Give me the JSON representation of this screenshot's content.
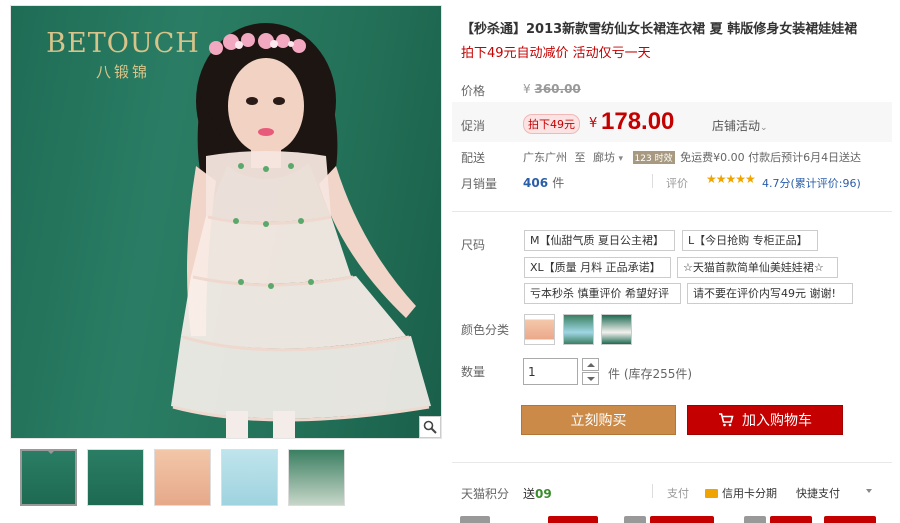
{
  "gallery": {
    "brand_en": "BETOUCH",
    "brand_cn": "八锻锦",
    "thumbnails": [
      "thumb-1",
      "thumb-2",
      "thumb-3",
      "thumb-4",
      "thumb-5"
    ]
  },
  "product": {
    "title": "【秒杀通】2013新款雪纺仙女长裙连衣裙 夏 韩版修身女装裙娃娃裙",
    "subtitle": "拍下49元自动减价 活动仅亏一天"
  },
  "price": {
    "label": "价格",
    "currency": "¥",
    "original": "360.00"
  },
  "promo": {
    "label": "促消",
    "tag": "拍下49元",
    "currency": "¥",
    "price": "178.00",
    "store_activity": "店铺活动"
  },
  "shipping": {
    "label": "配送",
    "from": "广东广州",
    "to_word": "至",
    "to": "廊坊",
    "badge": "123 时效",
    "fee": "免运费¥0.00 付款后预计6月4日送达"
  },
  "sales": {
    "label": "月销量",
    "count": "406",
    "unit": "件",
    "rating_label": "评价",
    "stars": "★★★★★",
    "rating_text": "4.7分(累计评价:96)"
  },
  "sizes": {
    "label": "尺码",
    "options": [
      "M【仙甜气质 夏日公主裙】",
      "L【今日抢购 专柜正品】",
      "XL【质量 月料 正品承诺】",
      "☆天猫首款简单仙美娃娃裙☆",
      "亏本秒杀 慎重评价 希望好评",
      "请不要在评价内写49元 谢谢!"
    ]
  },
  "colors": {
    "label": "颜色分类"
  },
  "quantity": {
    "label": "数量",
    "value": "1",
    "stock": "件 (库存255件)"
  },
  "actions": {
    "buy": "立刻购买",
    "cart": "加入购物车"
  },
  "points": {
    "label": "天猫积分",
    "prefix": "送",
    "value": "09",
    "pay_label": "支付",
    "credit": "信用卡分期",
    "quickpay": "快捷支付"
  }
}
